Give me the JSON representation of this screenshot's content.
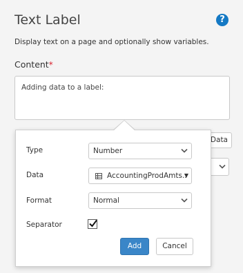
{
  "panel": {
    "title": "Text Label",
    "help_icon": "question-circle-icon",
    "description": "Display text on a page and optionally show variables.",
    "content_label": "Content",
    "required_marker": "*",
    "content_value": "Adding data to a label:",
    "insert_data_label": "Data"
  },
  "popover": {
    "type_label": "Type",
    "type_value": "Number",
    "data_label": "Data",
    "data_value": "AccountingProdAmts..",
    "data_icon": "table-icon",
    "format_label": "Format",
    "format_value": "Normal",
    "separator_label": "Separator",
    "separator_checked": true,
    "add_label": "Add",
    "cancel_label": "Cancel"
  },
  "colors": {
    "accent": "#3a86c8",
    "help_icon": "#1479c4",
    "required": "#d9232f"
  }
}
